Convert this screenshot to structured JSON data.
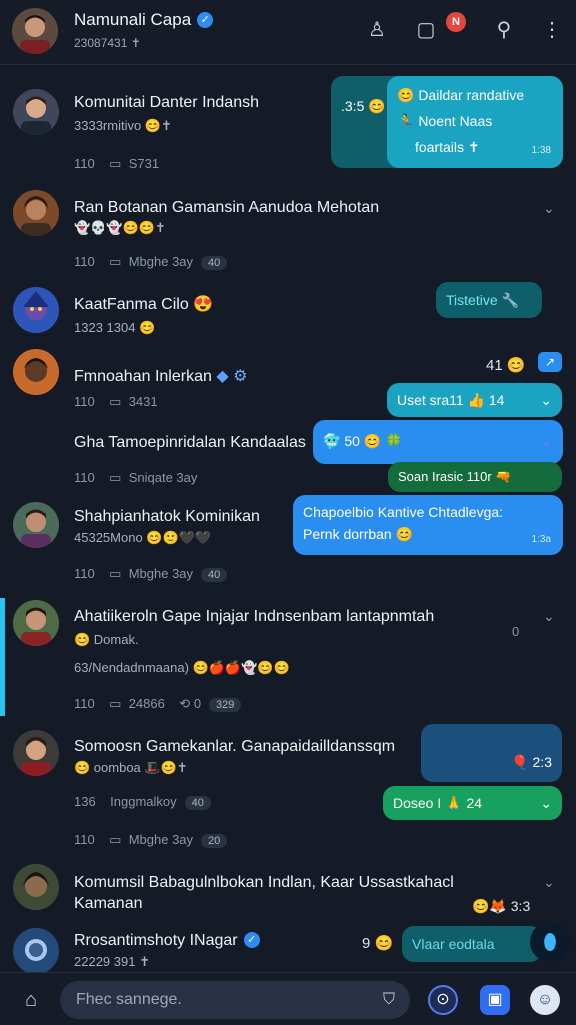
{
  "header": {
    "title": "Namunali Capa",
    "subtitle": "23087431 ✝",
    "verified_icon": "check-badge-icon",
    "notif_badge": "N"
  },
  "rows": [
    {
      "title": "Komunitai Danter Indansh",
      "sub": "3333rmitivo 😊✝",
      "meta_count": "110",
      "meta_replies": "S731",
      "pill": ""
    },
    {
      "title": "Ran Botanan Gamansin Aanudoa Mehotan",
      "sub": "👻💀👻😊😊✝",
      "meta_count": "110",
      "meta_replies": "Mbghe 3ay",
      "pill": "40"
    },
    {
      "title": "KaatFanma Cilo 😍",
      "sub": "1323 1304 😊",
      "meta_count": "",
      "meta_replies": "",
      "pill": ""
    },
    {
      "title": "Fmnoahan Inlerkan",
      "sub": "",
      "meta_count": "110",
      "meta_replies": "3431",
      "pill": ""
    },
    {
      "title": "Gha Tamoepinridalan Kandaalas",
      "sub": "",
      "meta_count": "110",
      "meta_replies": "Sniqate 3ay",
      "pill": ""
    },
    {
      "title": "Shahpianhatok Kominikan",
      "sub": "45325Mono 😊🙂🖤🖤",
      "meta_count": "110",
      "meta_replies": "Mbghe 3ay",
      "pill": "40"
    },
    {
      "title": "Ahatiikeroln Gape Injajar Indnsenbam lantapnmtah",
      "sub": "😊 Domak.",
      "sub2": "63/Nendadnmaana) 😊🍎🍎👻😊😊",
      "meta_count": "110",
      "meta_replies": "24866",
      "meta_extra": "0",
      "pill": "329"
    },
    {
      "title": "Somoosn Gamekanlar. Ganapaidailldanssqm",
      "sub": "😊 oomboa 🎩😊✝",
      "meta_count": "136",
      "meta_replies": "Inggmalkoy",
      "pill": "40",
      "meta2_count": "110",
      "meta2_replies": "Mbghe 3ay",
      "pill2": "20"
    },
    {
      "title": "Komumsil Babagulnlbokan Indlan, Kaar Ussastkahacl",
      "title2": "Kamanan",
      "sub": "",
      "meta_count": "",
      "meta_replies": "",
      "pill": ""
    },
    {
      "title": "Rrosantimshoty INagar",
      "sub": "22229 391 ✝",
      "meta_count": "",
      "meta_replies": "",
      "pill": ""
    }
  ],
  "bubbles": {
    "b1_top": "😊 Daildar randative",
    "b1_mid": "🏃 Noent Naas",
    "b1_bottom": "foartails ✝",
    "b1_left": ".3:5 😊",
    "b1_time": "1:38",
    "b2": "Tistetive 🔧",
    "b3": "Uset sra11 👍 14",
    "b3_left": "41 😊",
    "b4": "🥶 50 😊 🍀",
    "b5": "Soan Irasic 110r 🔫",
    "b6_line1": "Chapoelbio Kantive Chtadlevga:",
    "b6_line2": "Pernk dorrban 😊",
    "b6_time": "1:3a",
    "b7_time": "0",
    "b8": "🎈 2:3",
    "b9": "Doseo I 🙏 24",
    "b10_time": "3:3",
    "b11": "Vlaar eodtala",
    "b11_left": "9 😊"
  },
  "composer": {
    "placeholder": "Fhec sannege."
  }
}
